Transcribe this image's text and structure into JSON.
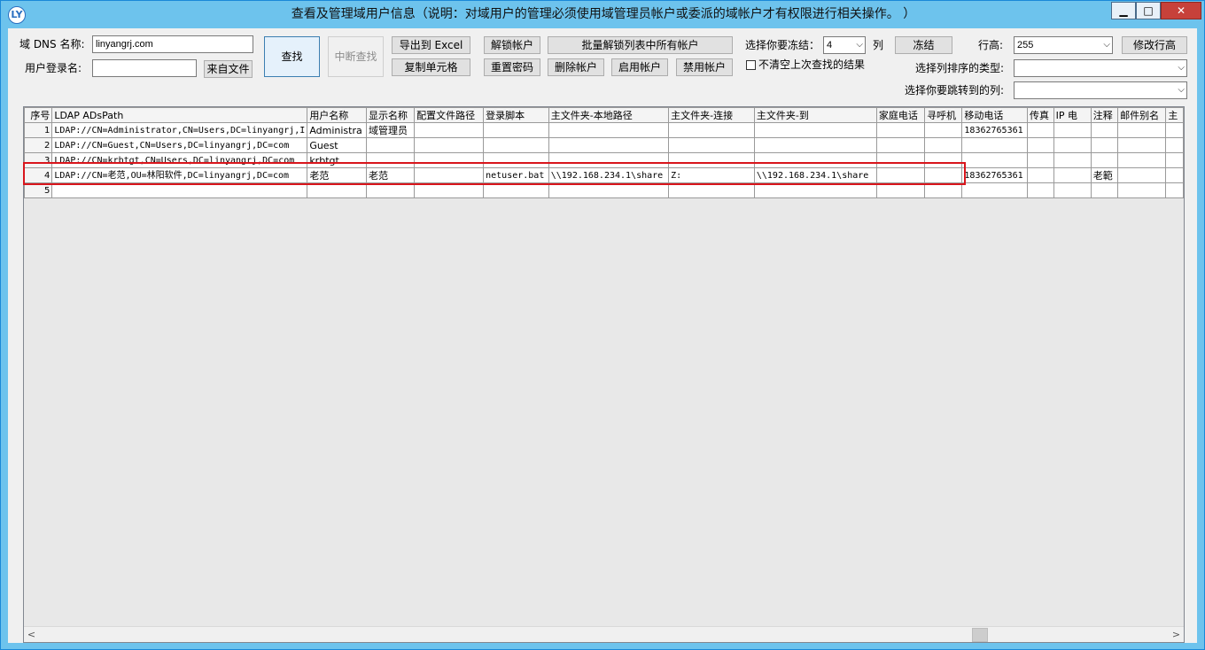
{
  "window": {
    "title": "查看及管理域用户信息（说明：对域用户的管理必须使用域管理员帐户或委派的域帐户才有权限进行相关操作。 ）",
    "app_icon": "LY",
    "minimize_icon": "▁",
    "maximize_icon": "□",
    "close_icon": "✕"
  },
  "form": {
    "dns_label": "域 DNS 名称:",
    "dns_value": "linyangrj.com",
    "login_label": "用户登录名:",
    "login_value": "",
    "from_file_button": "来自文件",
    "find_button": "查找",
    "stop_find_button": "中断查找",
    "export_excel_button": "导出到 Excel",
    "copy_cell_button": "复制单元格",
    "unlock_button": "解锁帐户",
    "reset_password_button": "重置密码",
    "batch_unlock_button": "批量解锁列表中所有帐户",
    "delete_button": "删除帐户",
    "enable_button": "启用帐户",
    "disable_button": "禁用帐户",
    "freeze_label": "选择你要冻结：",
    "freeze_value": "4",
    "freeze_unit": "列",
    "freeze_button": "冻结",
    "keep_results_label": "不清空上次查找的结果",
    "row_height_label": "行高:",
    "row_height_value": "255",
    "modify_row_height_button": "修改行高",
    "sort_label": "选择列排序的类型:",
    "sort_value": "",
    "jump_label": "选择你要跳转到的列:",
    "jump_value": "",
    "dropdown_arrow": "⌵"
  },
  "grid": {
    "columns": [
      "序号",
      "LDAP ADsPath",
      "用户名称",
      "显示名称",
      "配置文件路径",
      "登录脚本",
      "主文件夹-本地路径",
      "主文件夹-连接",
      "主文件夹-到",
      "家庭电话",
      "寻呼机",
      "移动电话",
      "传真",
      "IP 电",
      "注释",
      "邮件别名",
      "主"
    ],
    "rows": [
      {
        "no": "1",
        "path": "LDAP://CN=Administrator,CN=Users,DC=linyangrj,I",
        "user": "Administra",
        "display": "域管理员",
        "profile": "",
        "script": "",
        "local": "",
        "connect": "",
        "to": "",
        "home": "",
        "pager": "",
        "mobile": "18362765361",
        "fax": "",
        "ip": "",
        "comment": "",
        "alias": "",
        "extra": ""
      },
      {
        "no": "2",
        "path": "LDAP://CN=Guest,CN=Users,DC=linyangrj,DC=com",
        "user": "Guest",
        "display": "",
        "profile": "",
        "script": "",
        "local": "",
        "connect": "",
        "to": "",
        "home": "",
        "pager": "",
        "mobile": "",
        "fax": "",
        "ip": "",
        "comment": "",
        "alias": "",
        "extra": ""
      },
      {
        "no": "3",
        "path": "LDAP://CN=krbtgt,CN=Users,DC=linyangrj,DC=com",
        "user": "krbtgt",
        "display": "",
        "profile": "",
        "script": "",
        "local": "",
        "connect": "",
        "to": "",
        "home": "",
        "pager": "",
        "mobile": "",
        "fax": "",
        "ip": "",
        "comment": "",
        "alias": "",
        "extra": ""
      },
      {
        "no": "4",
        "path": "LDAP://CN=老范,OU=林阳软件,DC=linyangrj,DC=com",
        "user": "老范",
        "display": "老范",
        "profile": "",
        "script": "netuser.bat",
        "local": "\\\\192.168.234.1\\share",
        "connect": "Z:",
        "to": "\\\\192.168.234.1\\share",
        "home": "",
        "pager": "",
        "mobile": "18362765361",
        "fax": "",
        "ip": "",
        "comment": "老範",
        "alias": "",
        "extra": ""
      },
      {
        "no": "5",
        "path": "",
        "user": "",
        "display": "",
        "profile": "",
        "script": "",
        "local": "",
        "connect": "",
        "to": "",
        "home": "",
        "pager": "",
        "mobile": "",
        "fax": "",
        "ip": "",
        "comment": "",
        "alias": "",
        "extra": ""
      }
    ],
    "scroll_left_icon": "<",
    "scroll_right_icon": ">"
  },
  "colors": {
    "titlebar": "#6dc3ed",
    "highlight": "#d9151c",
    "face": "#f0f0f0"
  }
}
